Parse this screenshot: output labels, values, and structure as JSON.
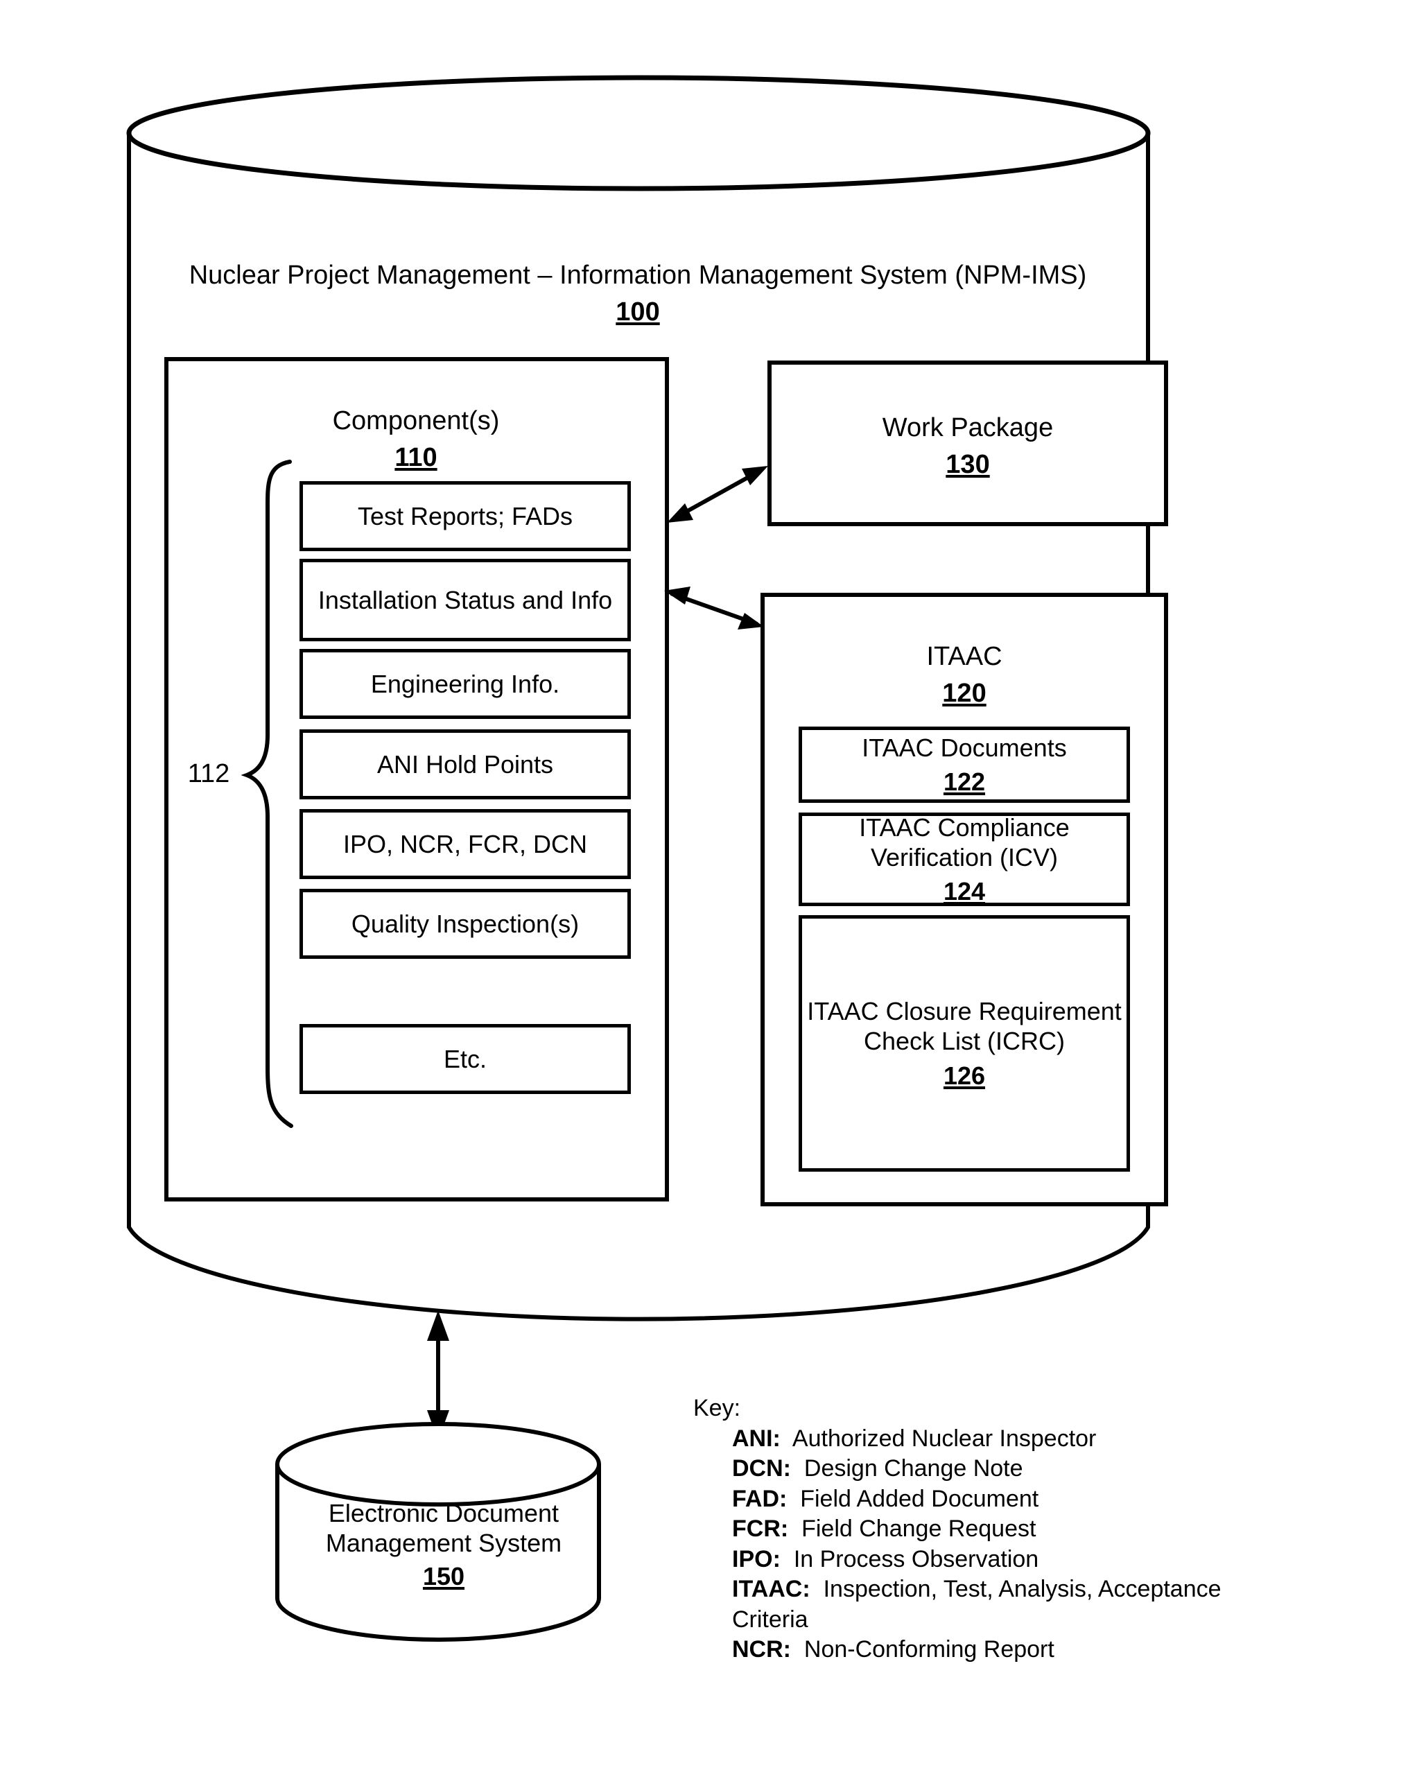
{
  "system": {
    "title": "Nuclear Project Management – Information Management System (NPM-IMS)",
    "ref": "100"
  },
  "components": {
    "title": "Component(s)",
    "ref": "110",
    "group_ref": "112",
    "items": [
      "Test Reports; FADs",
      "Installation Status and Info",
      "Engineering Info.",
      "ANI Hold Points",
      "IPO, NCR, FCR, DCN",
      "Quality Inspection(s)",
      "Etc."
    ]
  },
  "work_package": {
    "title": "Work Package",
    "ref": "130"
  },
  "itaac": {
    "title": "ITAAC",
    "ref": "120",
    "items": [
      {
        "title": "ITAAC Documents",
        "ref": "122"
      },
      {
        "title": "ITAAC Compliance Verification (ICV)",
        "ref": "124"
      },
      {
        "title": "ITAAC Closure Requirement Check List (ICRC)",
        "ref": "126"
      }
    ]
  },
  "edms": {
    "title": "Electronic Document Management System",
    "ref": "150"
  },
  "key": {
    "heading": "Key:",
    "entries": [
      {
        "abbr": "ANI:",
        "definition": "Authorized Nuclear Inspector"
      },
      {
        "abbr": "DCN:",
        "definition": "Design Change Note"
      },
      {
        "abbr": "FAD:",
        "definition": "Field Added Document"
      },
      {
        "abbr": "FCR:",
        "definition": "Field Change Request"
      },
      {
        "abbr": "IPO:",
        "definition": "In Process Observation"
      },
      {
        "abbr": "ITAAC:",
        "definition": "Inspection, Test, Analysis, Acceptance Criteria"
      },
      {
        "abbr": "NCR:",
        "definition": "Non-Conforming Report"
      }
    ]
  },
  "colors": {
    "stroke": "#000000",
    "background": "#ffffff"
  }
}
